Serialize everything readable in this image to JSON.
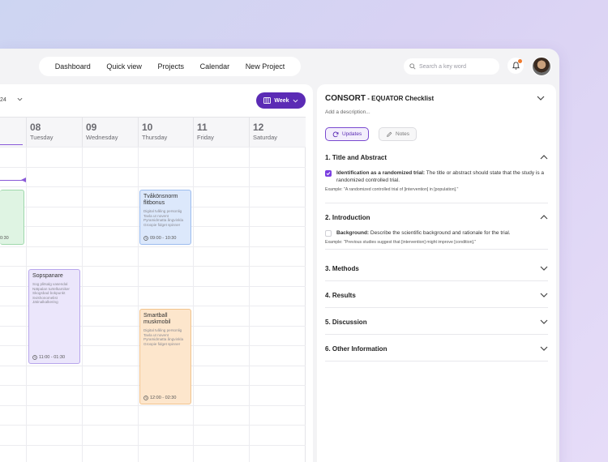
{
  "nav": {
    "items": [
      "Dashboard",
      "Quick view",
      "Projects",
      "Calendar",
      "New Project"
    ],
    "search_placeholder": "Search a key word"
  },
  "calendar": {
    "date_fragment": "24",
    "view_label": "Week",
    "days": [
      {
        "num": "08",
        "name": "Tuesday"
      },
      {
        "num": "09",
        "name": "Wednesday"
      },
      {
        "num": "10",
        "name": "Thursday"
      },
      {
        "num": "11",
        "name": "Friday"
      },
      {
        "num": "12",
        "name": "Saturday"
      }
    ],
    "events": {
      "green_time": "0:30",
      "blue": {
        "title": "Tvåkönsnorm flitbonus",
        "desc": "Digital tvåling personlig\nTavla ut novent\nPyramidmatta ångvinkla\nGroopie fidget spinner",
        "time": "09:00 - 10:30"
      },
      "violet": {
        "title": "Sopspanare",
        "desc": "Sog plitsalg vasendal\nNätpalan turtelkamiker\nSkogsbad bokpunkt\nSvishonomelist\nJätinalkalkering",
        "time": "11:00 - 01:30"
      },
      "orange": {
        "title": "Smartball muskmobil",
        "desc": "Digital tvåling personlig\nTavla ut novent\nPyramidmatta ångvinkla\nGroopie fidget spinner",
        "time": "12:00 - 02:30"
      }
    }
  },
  "checklist": {
    "title_main": "CONSORT",
    "title_sep": " - ",
    "title_sub": "EQUATOR Checklist",
    "description": "Add a description...",
    "tabs": {
      "updates": "Updates",
      "notes": "Notes"
    },
    "sections": [
      {
        "title": "1. Title and Abstract",
        "item_label": "Identification as a randomized trial:",
        "item_text": " The title or abstract should state that the study is a randomized controlled trial.",
        "example": "Example: \"A randomized controlled trial of [intervention] in [population].\""
      },
      {
        "title": "2. Introduction",
        "item_label": "Background:",
        "item_text": " Describe the scientific background and rationale for the trial.",
        "example": "Example: \"Previous studies suggest that [intervention] might improve [condition].\""
      },
      {
        "title": "3. Methods"
      },
      {
        "title": "4. Results"
      },
      {
        "title": "5. Discussion"
      },
      {
        "title": "6. Other Information"
      }
    ]
  },
  "colors": {
    "accent": "#5b2bb5",
    "checkbox": "#7a3ee0"
  }
}
